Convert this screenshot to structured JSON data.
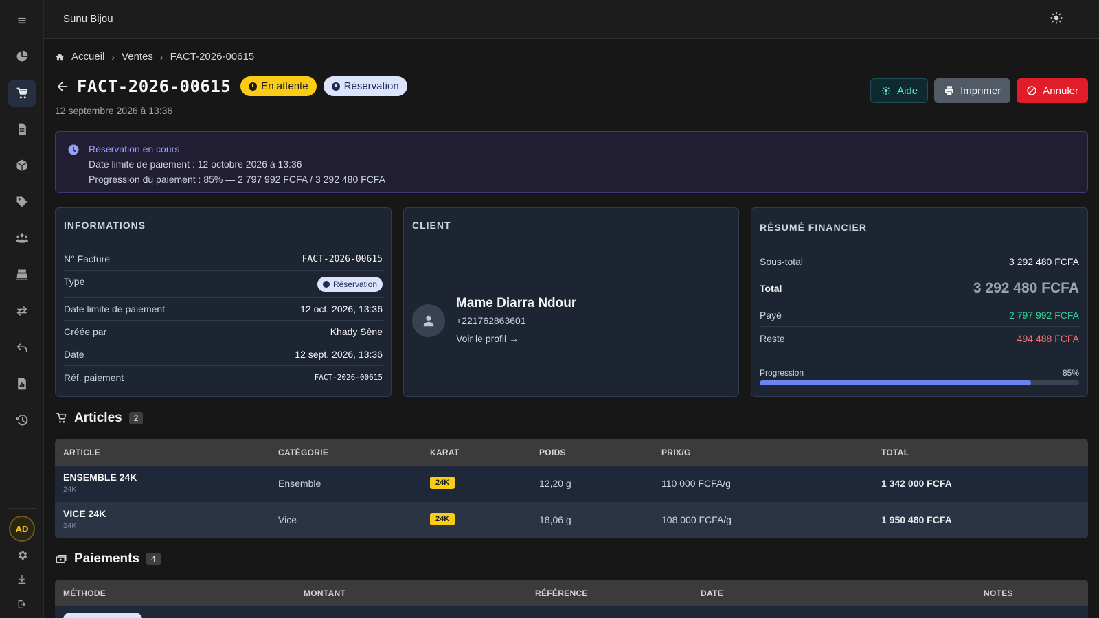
{
  "app": {
    "title": "Sunu Bijou"
  },
  "sidebar": {
    "items": [
      {
        "name": "sidebar-item-dashboard",
        "icon": "pie-chart-icon"
      },
      {
        "name": "sidebar-item-sales",
        "icon": "cart-icon",
        "active": true
      },
      {
        "name": "sidebar-item-documents",
        "icon": "document-icon"
      },
      {
        "name": "sidebar-item-products",
        "icon": "box-icon"
      },
      {
        "name": "sidebar-item-tags",
        "icon": "tag-icon"
      },
      {
        "name": "sidebar-item-clients",
        "icon": "users-icon"
      },
      {
        "name": "sidebar-item-cashier",
        "icon": "cash-register-icon"
      },
      {
        "name": "sidebar-item-transfers",
        "icon": "transfer-icon"
      },
      {
        "name": "sidebar-item-returns",
        "icon": "undo-icon"
      },
      {
        "name": "sidebar-item-reports",
        "icon": "report-icon"
      },
      {
        "name": "sidebar-item-history",
        "icon": "history-icon"
      }
    ],
    "avatar_initials": "AD"
  },
  "breadcrumb": {
    "home": "Accueil",
    "section": "Ventes",
    "current": "FACT-2026-00615"
  },
  "header": {
    "title": "FACT-2026-00615",
    "status_badge": "En attente",
    "type_badge": "Réservation",
    "date": "12 septembre 2026 à 13:36",
    "help_label": "Aide",
    "print_label": "Imprimer",
    "cancel_label": "Annuler"
  },
  "alert": {
    "title": "Réservation en cours",
    "line1": "Date limite de paiement : 12 octobre 2026 à 13:36",
    "line2": "Progression du paiement : 85% — 2 797 992 FCFA / 3 292 480 FCFA"
  },
  "info": {
    "heading": "INFORMATIONS",
    "invoice_label": "N° Facture",
    "invoice_value": "FACT-2026-00615",
    "type_label": "Type",
    "type_value": "Réservation",
    "deadline_label": "Date limite de paiement",
    "deadline_value": "12 oct. 2026, 13:36",
    "created_label": "Créée par",
    "created_value": "Khady Sène",
    "date_label": "Date",
    "date_value": "12 sept. 2026, 13:36",
    "ref_label": "Réf. paiement",
    "ref_value": "FACT-2026-00615"
  },
  "client": {
    "heading": "CLIENT",
    "name": "Mame Diarra Ndour",
    "phone": "+221762863601",
    "profile_link": "Voir le profil →"
  },
  "finance": {
    "heading": "RÉSUMÉ FINANCIER",
    "subtotal_label": "Sous-total",
    "subtotal_value": "3 292 480 FCFA",
    "total_label": "Total",
    "total_value": "3 292 480 FCFA",
    "paid_label": "Payé",
    "paid_value": "2 797 992 FCFA",
    "rest_label": "Reste",
    "rest_value": "494 488 FCFA",
    "progress_label": "Progression",
    "progress_text": "85%",
    "progress_value": 85,
    "colors": {
      "paid": "#34d399",
      "rest": "#f87171",
      "progress": "#6d83f2"
    }
  },
  "articles": {
    "title": "Articles",
    "count": "2",
    "headers": [
      "ARTICLE",
      "CATÉGORIE",
      "KARAT",
      "POIDS",
      "PRIX/G",
      "TOTAL"
    ],
    "rows": [
      {
        "name": "ENSEMBLE 24K",
        "sub": "24K",
        "category": "Ensemble",
        "karat": "24K",
        "weight": "12,20 g",
        "price": "110 000 FCFA/g",
        "total": "1 342 000 FCFA"
      },
      {
        "name": "VICE 24K",
        "sub": "24K",
        "category": "Vice",
        "karat": "24K",
        "weight": "18,06 g",
        "price": "108 000 FCFA/g",
        "total": "1 950 480 FCFA"
      }
    ]
  },
  "payments": {
    "title": "Paiements",
    "count": "4",
    "headers": [
      "MÉTHODE",
      "MONTANT",
      "RÉFÉRENCE",
      "DATE",
      "NOTES"
    ]
  }
}
